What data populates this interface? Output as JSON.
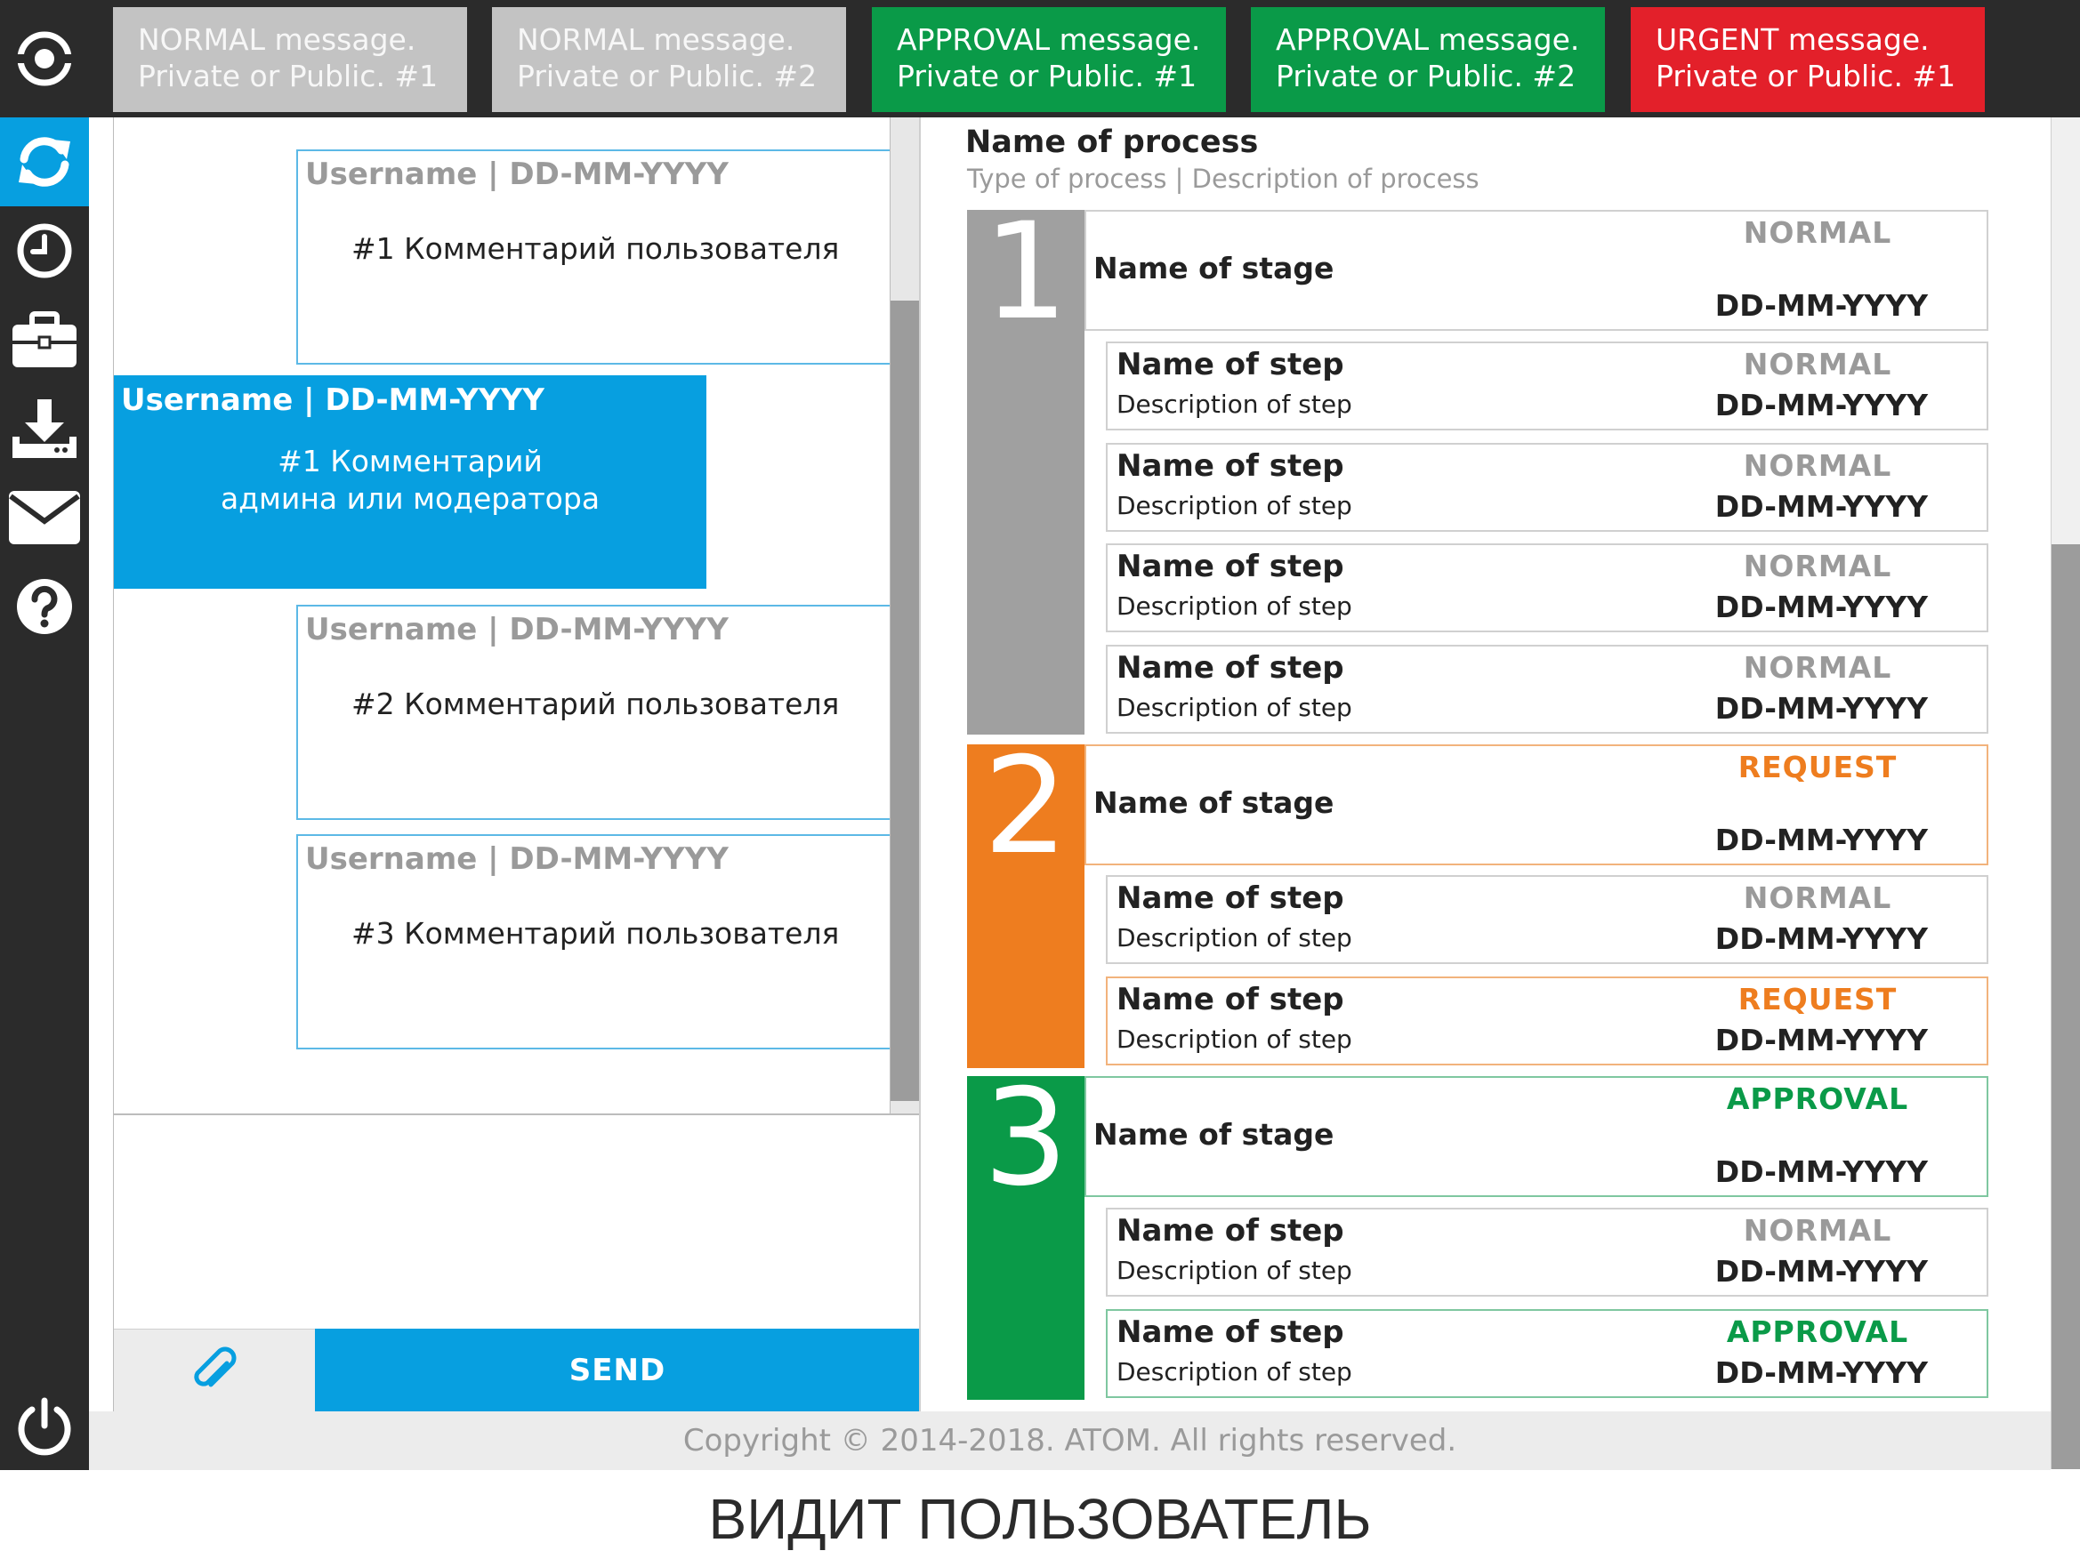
{
  "sidebar": {
    "items": [
      {
        "icon": "logo-eye-icon"
      },
      {
        "icon": "refresh-icon",
        "active": true
      },
      {
        "icon": "clock-icon"
      },
      {
        "icon": "briefcase-icon"
      },
      {
        "icon": "download-icon"
      },
      {
        "icon": "mail-icon"
      },
      {
        "icon": "help-icon"
      },
      {
        "icon": "power-icon"
      }
    ]
  },
  "notifications": [
    {
      "type": "normal",
      "line1": "NORMAL message.",
      "line2": "Private or Public. #1"
    },
    {
      "type": "normal",
      "line1": "NORMAL message.",
      "line2": "Private or Public. #2"
    },
    {
      "type": "approval",
      "line1": "APPROVAL message.",
      "line2": "Private or Public. #1"
    },
    {
      "type": "approval",
      "line1": "APPROVAL message.",
      "line2": "Private or Public. #2"
    },
    {
      "type": "urgent",
      "line1": "URGENT message.",
      "line2": "Private or Public. #1"
    }
  ],
  "chat": {
    "comments": [
      {
        "role": "user",
        "header": "Username | DD-MM-YYYY",
        "text": "#1 Комментарий пользователя"
      },
      {
        "role": "admin",
        "header": "Username | DD-MM-YYYY",
        "text_line1": "#1 Комментарий",
        "text_line2": "админа или модератора"
      },
      {
        "role": "user",
        "header": "Username | DD-MM-YYYY",
        "text": "#2 Комментарий пользователя"
      },
      {
        "role": "user",
        "header": "Username | DD-MM-YYYY",
        "text": "#3 Комментарий пользователя"
      }
    ],
    "input_value": "",
    "attach_icon": "paperclip-icon",
    "send_label": "SEND"
  },
  "process": {
    "name": "Name of process",
    "description": "Type of process | Description of process",
    "stages": [
      {
        "number": "1",
        "color": "#a0a0a0",
        "name": "Name of stage",
        "status": "NORMAL",
        "date": "DD-MM-YYYY",
        "steps": [
          {
            "name": "Name of step",
            "description": "Description of step",
            "status": "NORMAL",
            "date": "DD-MM-YYYY"
          },
          {
            "name": "Name of step",
            "description": "Description of step",
            "status": "NORMAL",
            "date": "DD-MM-YYYY"
          },
          {
            "name": "Name of step",
            "description": "Description of step",
            "status": "NORMAL",
            "date": "DD-MM-YYYY"
          },
          {
            "name": "Name of step",
            "description": "Description of step",
            "status": "NORMAL",
            "date": "DD-MM-YYYY"
          }
        ]
      },
      {
        "number": "2",
        "color": "#ee7d1f",
        "name": "Name of stage",
        "status": "REQUEST",
        "date": "DD-MM-YYYY",
        "steps": [
          {
            "name": "Name of step",
            "description": "Description of step",
            "status": "NORMAL",
            "date": "DD-MM-YYYY"
          },
          {
            "name": "Name of step",
            "description": "Description of step",
            "status": "REQUEST",
            "date": "DD-MM-YYYY"
          }
        ]
      },
      {
        "number": "3",
        "color": "#0a9a48",
        "name": "Name of stage",
        "status": "APPROVAL",
        "date": "DD-MM-YYYY",
        "steps": [
          {
            "name": "Name of step",
            "description": "Description of step",
            "status": "NORMAL",
            "date": "DD-MM-YYYY"
          },
          {
            "name": "Name of step",
            "description": "Description of step",
            "status": "APPROVAL",
            "date": "DD-MM-YYYY"
          }
        ]
      }
    ]
  },
  "footer": {
    "copyright": "Copyright © 2014-2018. ATOM. All rights reserved."
  },
  "caption": "ВИДИТ ПОЛЬЗОВАТЕЛЬ",
  "colors": {
    "accent": "#079fe0",
    "dark": "#2b2b2b",
    "normal": "#9a9a9a",
    "request": "#ee7d1f",
    "approval": "#0a9a48",
    "urgent": "#e3202a"
  }
}
